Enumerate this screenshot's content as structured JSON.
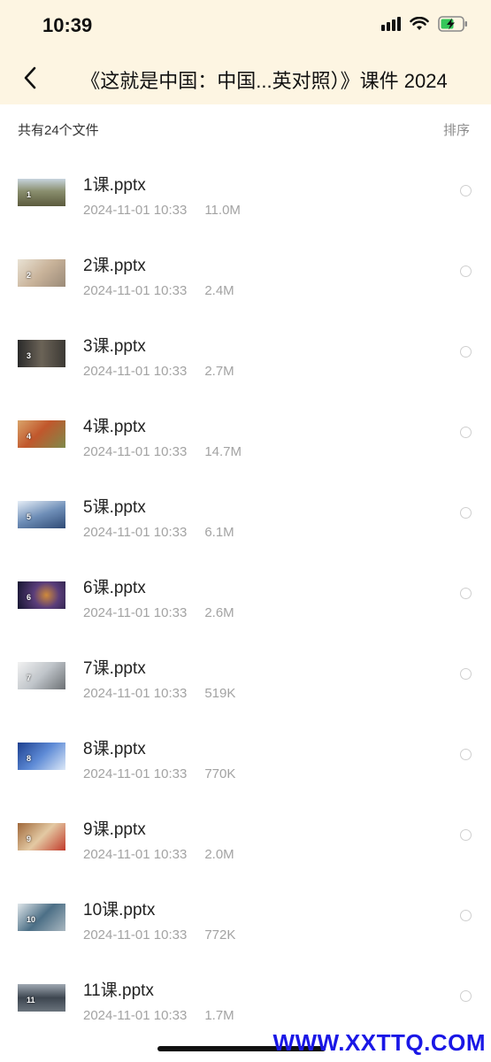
{
  "status_bar": {
    "time": "10:39",
    "icons": [
      "signal-icon",
      "wifi-icon",
      "battery-charging-icon"
    ],
    "battery_color": "#34c759"
  },
  "nav": {
    "back_icon": "chevron-left-icon",
    "title": "《这就是中国：中国...英对照）》课件 2024"
  },
  "subbar": {
    "file_count": "共有24个文件",
    "sort_label": "排序"
  },
  "files": [
    {
      "slide": "1",
      "name": "1课.pptx",
      "date": "2024-11-01 10:33",
      "size": "11.0M"
    },
    {
      "slide": "2",
      "name": "2课.pptx",
      "date": "2024-11-01 10:33",
      "size": "2.4M"
    },
    {
      "slide": "3",
      "name": "3课.pptx",
      "date": "2024-11-01 10:33",
      "size": "2.7M"
    },
    {
      "slide": "4",
      "name": "4课.pptx",
      "date": "2024-11-01 10:33",
      "size": "14.7M"
    },
    {
      "slide": "5",
      "name": "5课.pptx",
      "date": "2024-11-01 10:33",
      "size": "6.1M"
    },
    {
      "slide": "6",
      "name": "6课.pptx",
      "date": "2024-11-01 10:33",
      "size": "2.6M"
    },
    {
      "slide": "7",
      "name": "7课.pptx",
      "date": "2024-11-01 10:33",
      "size": "519K"
    },
    {
      "slide": "8",
      "name": "8课.pptx",
      "date": "2024-11-01 10:33",
      "size": "770K"
    },
    {
      "slide": "9",
      "name": "9课.pptx",
      "date": "2024-11-01 10:33",
      "size": "2.0M"
    },
    {
      "slide": "10",
      "name": "10课.pptx",
      "date": "2024-11-01 10:33",
      "size": "772K"
    },
    {
      "slide": "11",
      "name": "11课.pptx",
      "date": "2024-11-01 10:33",
      "size": "1.7M"
    }
  ],
  "colors": {
    "header_bg": "#fdf5e2",
    "meta_text": "#a3a3a3",
    "watermark": "#1a17e6"
  },
  "watermark": "WWW.XXTTQ.COM"
}
